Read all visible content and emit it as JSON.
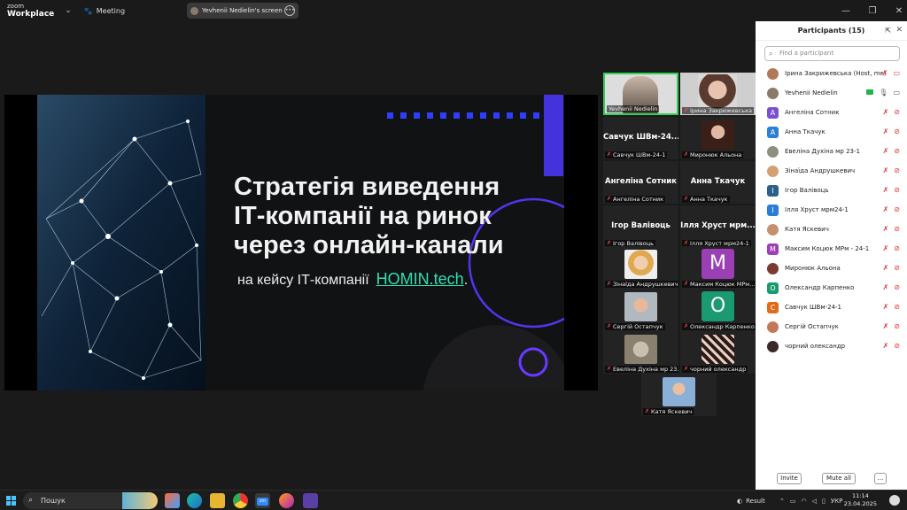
{
  "titlebar": {
    "app_line1": "zoom",
    "app_line2": "Workplace",
    "meeting_label": "Meeting",
    "share_label": "Yevhenii Nedielin's screen"
  },
  "slide": {
    "title_lines": [
      "Стратегія виведення",
      "ІТ-компанії на ринок",
      "через онлайн-канали"
    ],
    "subtitle": "на кейсу ІТ-компанії",
    "brand": "HOMIN.tech",
    "brand_suffix": ".",
    "accent_color": "#2fe0b4"
  },
  "gallery": {
    "tiles": [
      {
        "name": "Yevhenii Nedielin",
        "active": true
      },
      {
        "name": "Ірина Закрижевська"
      },
      {
        "name": "Савчук ШВм-24-1",
        "big": "Савчук ШВм-24..."
      },
      {
        "name": "Миронюк Альона"
      },
      {
        "name": "Ангеліна Сотник",
        "big": "Ангеліна Сотник"
      },
      {
        "name": "Анна Ткачук",
        "big": "Анна Ткачук"
      },
      {
        "name": "Ігор Валівоць",
        "big": "Ігор Валівоць"
      },
      {
        "name": "Ілля Хруст мрм24-1",
        "big": "Ілля Хруст мрм..."
      },
      {
        "name": "Зінаїда Андрушкевич"
      },
      {
        "name": "Максим Коцюк МРм...",
        "letter": "M"
      },
      {
        "name": "Сергій Остапчук"
      },
      {
        "name": "Олександр Карпенко",
        "letter": "O"
      },
      {
        "name": "Евеліна Духіна мр 23..."
      },
      {
        "name": "чорний олександр"
      },
      {
        "name": "Катя Яскевич"
      }
    ]
  },
  "participants": {
    "title": "Participants (15)",
    "search_placeholder": "Find a participant",
    "items": [
      {
        "name": "Ірина Закрижевська (Host, me)",
        "avatar": "photo",
        "color": "#b07a5a"
      },
      {
        "name": "Yevhenii Nedielin",
        "avatar": "photo",
        "color": "#8a7a6a"
      },
      {
        "name": "Ангеліна Сотник",
        "avatar": "A",
        "color": "#7b4fd3"
      },
      {
        "name": "Анна Ткачук",
        "avatar": "A",
        "color": "#2a7fd4"
      },
      {
        "name": "Евеліна Духіна мр 23-1",
        "avatar": "photo",
        "color": "#8f8f7f"
      },
      {
        "name": "Зінаїда Андрушкевич",
        "avatar": "photo",
        "color": "#d4a070"
      },
      {
        "name": "Ігор Валівоць",
        "avatar": "I",
        "color": "#2c5f8a"
      },
      {
        "name": "Ілля Хруст мрм24-1",
        "avatar": "I",
        "color": "#2a7fd4"
      },
      {
        "name": "Катя Яскевич",
        "avatar": "photo",
        "color": "#c49070"
      },
      {
        "name": "Максим Коцюк МРм - 24-1",
        "avatar": "M",
        "color": "#9b3fb5"
      },
      {
        "name": "Миронюк Альона",
        "avatar": "photo",
        "color": "#7a3a30"
      },
      {
        "name": "Олександр Карпенко",
        "avatar": "O",
        "color": "#1a9a70"
      },
      {
        "name": "Савчук ШВм-24-1",
        "avatar": "C",
        "color": "#e06a1a"
      },
      {
        "name": "Сергій Остапчук",
        "avatar": "photo",
        "color": "#c07a5a"
      },
      {
        "name": "чорний олександр",
        "avatar": "photo",
        "color": "#3a2a2a"
      }
    ],
    "invite_label": "Invite",
    "mute_all_label": "Mute all",
    "more_label": "..."
  },
  "taskbar": {
    "search_label": "Пошук",
    "result_label": "Result",
    "lang": "УКР",
    "time": "11:14",
    "date": "23.04.2025"
  }
}
